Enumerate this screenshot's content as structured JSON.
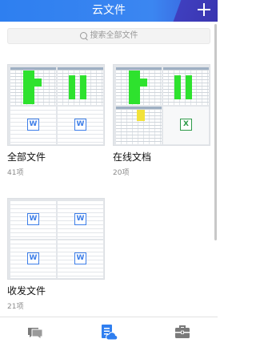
{
  "header": {
    "title": "云文件",
    "add_icon": "plus-icon"
  },
  "search": {
    "placeholder": "搜索全部文件",
    "icon": "search-icon"
  },
  "folders": [
    {
      "name": "全部文件",
      "count": "41项"
    },
    {
      "name": "在线文档",
      "count": "20项"
    },
    {
      "name": "收发文件",
      "count": "21项"
    }
  ],
  "doc_badge": "W",
  "sheet_badge": "X",
  "bottom_nav": {
    "items": [
      {
        "icon": "chat-icon",
        "active": false
      },
      {
        "icon": "cloud-doc-icon",
        "active": true
      },
      {
        "icon": "briefcase-icon",
        "active": false
      }
    ]
  },
  "colors": {
    "header": "#3b86f1",
    "accent": "#2f7ff0",
    "inactive_icon": "#7a7a7a"
  }
}
